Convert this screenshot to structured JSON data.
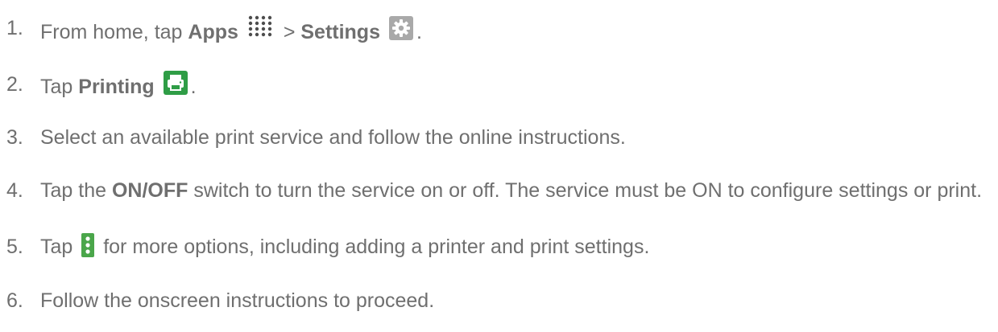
{
  "steps": [
    {
      "number": "1.",
      "parts": [
        "From home, tap ",
        "Apps",
        " > ",
        "Settings",
        "."
      ],
      "icons": [
        "apps-grid-icon",
        "settings-gear-icon"
      ]
    },
    {
      "number": "2.",
      "parts": [
        "Tap ",
        "Printing",
        "."
      ],
      "icons": [
        "printing-icon"
      ]
    },
    {
      "number": "3.",
      "text": "Select an available print service and follow the online instructions."
    },
    {
      "number": "4.",
      "parts": [
        "Tap the ",
        "ON/OFF",
        " switch to turn the service on or off. The service must be ON to configure settings or print."
      ]
    },
    {
      "number": "5.",
      "parts": [
        "Tap ",
        " for more options, including adding a printer and print settings."
      ],
      "icons": [
        "more-options-icon"
      ]
    },
    {
      "number": "6.",
      "text": "Follow the onscreen instructions to proceed."
    }
  ],
  "colors": {
    "text": "#6f6f6f",
    "settings_icon_bg": "#a9a9a9",
    "printing_icon_bg": "#2f9d46",
    "menu_icon_bg": "#4aa64a"
  }
}
